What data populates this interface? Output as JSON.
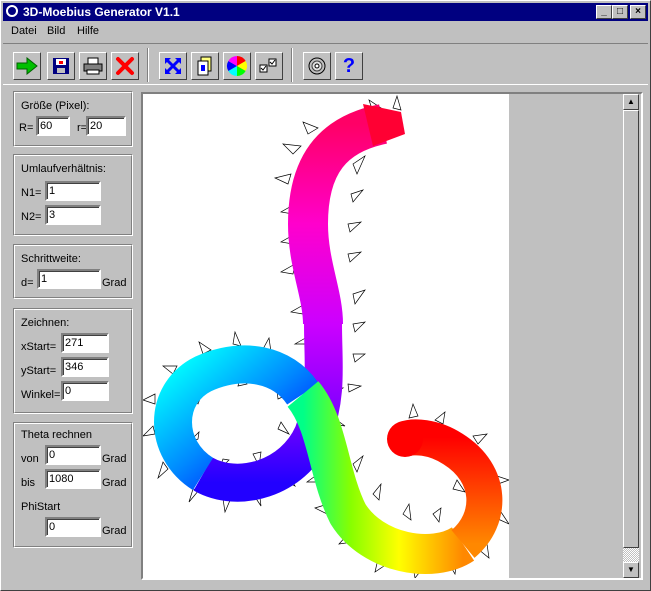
{
  "window": {
    "title": "3D-Moebius Generator V1.1",
    "minimize": "_",
    "maximize": "□",
    "close": "×"
  },
  "menu": [
    "Datei",
    "Bild",
    "Hilfe"
  ],
  "toolbar": {
    "icons": [
      "start-arrow-icon",
      "save-icon",
      "print-icon",
      "delete-icon",
      "fullscreen-icon",
      "copy-icon",
      "color-wheel-icon",
      "options-icon",
      "disc-icon",
      "help-icon"
    ],
    "help_glyph": "?"
  },
  "size": {
    "label": "Größe (Pixel):",
    "R_label": "R=",
    "R_value": "60",
    "r_label": "r=",
    "r_value": "20"
  },
  "ratio": {
    "label": "Umlaufverhältnis:",
    "N1_label": "N1=",
    "N1_value": "1",
    "N2_label": "N2=",
    "N2_value": "3"
  },
  "step": {
    "label": "Schrittweite:",
    "d_label": "d=",
    "d_value": "1",
    "unit": "Grad"
  },
  "draw": {
    "label": "Zeichnen:",
    "xstart_label": "xStart=",
    "xstart_value": "271",
    "ystart_label": "yStart=",
    "ystart_value": "346",
    "angle_label": "Winkel=",
    "angle_value": "0"
  },
  "theta": {
    "label": "Theta rechnen",
    "from_label": "von",
    "from_value": "0",
    "to_label": "bis",
    "to_value": "1080",
    "unit": "Grad",
    "phistart_label": "PhiStart",
    "phistart_value": "0",
    "phi_unit": "Grad"
  },
  "scroll": {
    "up": "▲",
    "down": "▼"
  }
}
